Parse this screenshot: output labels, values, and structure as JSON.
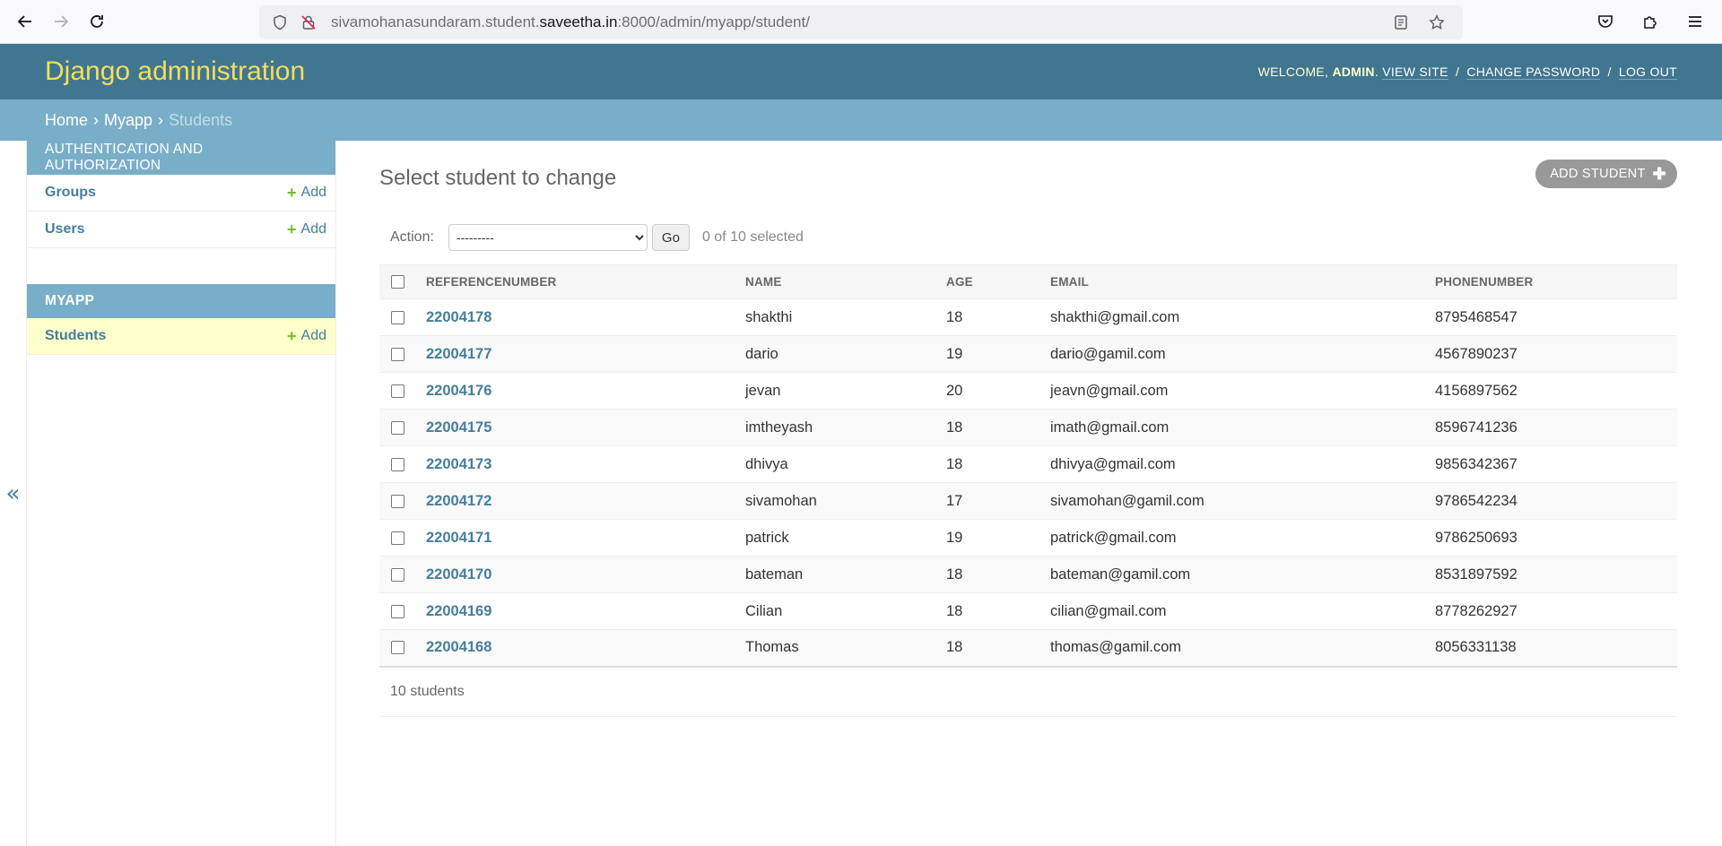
{
  "browser": {
    "url_prefix": "sivamohanasundaram.student.",
    "url_host": "saveetha.in",
    "url_suffix": ":8000/admin/myapp/student/"
  },
  "header": {
    "branding": "Django administration",
    "welcome": "Welcome,",
    "username": "admin",
    "view_site": "View site",
    "change_password": "Change password",
    "log_out": "Log out"
  },
  "breadcrumbs": {
    "home": "Home",
    "app": "Myapp",
    "current": "Students"
  },
  "sidebar": {
    "auth_caption": "Authentication and Authorization",
    "auth_models": [
      {
        "label": "Groups",
        "add": "Add"
      },
      {
        "label": "Users",
        "add": "Add"
      }
    ],
    "app_caption": "Myapp",
    "app_models": [
      {
        "label": "Students",
        "add": "Add"
      }
    ],
    "toggle": "«"
  },
  "content": {
    "title": "Select student to change",
    "add_button": "Add student",
    "action_label": "Action:",
    "action_selected": "---------",
    "go_label": "Go",
    "counter": "0 of 10 selected",
    "columns": [
      "ReferenceNumber",
      "Name",
      "Age",
      "Email",
      "PhoneNumber"
    ],
    "rows": [
      {
        "ref": "22004178",
        "name": "shakthi",
        "age": "18",
        "email": "shakthi@gmail.com",
        "phone": "8795468547"
      },
      {
        "ref": "22004177",
        "name": "dario",
        "age": "19",
        "email": "dario@gamil.com",
        "phone": "4567890237"
      },
      {
        "ref": "22004176",
        "name": "jevan",
        "age": "20",
        "email": "jeavn@gmail.com",
        "phone": "4156897562"
      },
      {
        "ref": "22004175",
        "name": "imtheyash",
        "age": "18",
        "email": "imath@gmail.com",
        "phone": "8596741236"
      },
      {
        "ref": "22004173",
        "name": "dhivya",
        "age": "18",
        "email": "dhivya@gmail.com",
        "phone": "9856342367"
      },
      {
        "ref": "22004172",
        "name": "sivamohan",
        "age": "17",
        "email": "sivamohan@gamil.com",
        "phone": "9786542234"
      },
      {
        "ref": "22004171",
        "name": "patrick",
        "age": "19",
        "email": "patrick@gmail.com",
        "phone": "9786250693"
      },
      {
        "ref": "22004170",
        "name": "bateman",
        "age": "18",
        "email": "bateman@gamil.com",
        "phone": "8531897592"
      },
      {
        "ref": "22004169",
        "name": "Cilian",
        "age": "18",
        "email": "cilian@gmail.com",
        "phone": "8778262927"
      },
      {
        "ref": "22004168",
        "name": "Thomas",
        "age": "18",
        "email": "thomas@gamil.com",
        "phone": "8056331138"
      }
    ],
    "paginator": "10 students"
  },
  "colors": {
    "header_bg": "#417690",
    "branding": "#f5dd5d",
    "breadcrumb_bg": "#79aec8",
    "link": "#447e9b",
    "add_green": "#70bf2b",
    "current_row": "#ffffcc"
  }
}
